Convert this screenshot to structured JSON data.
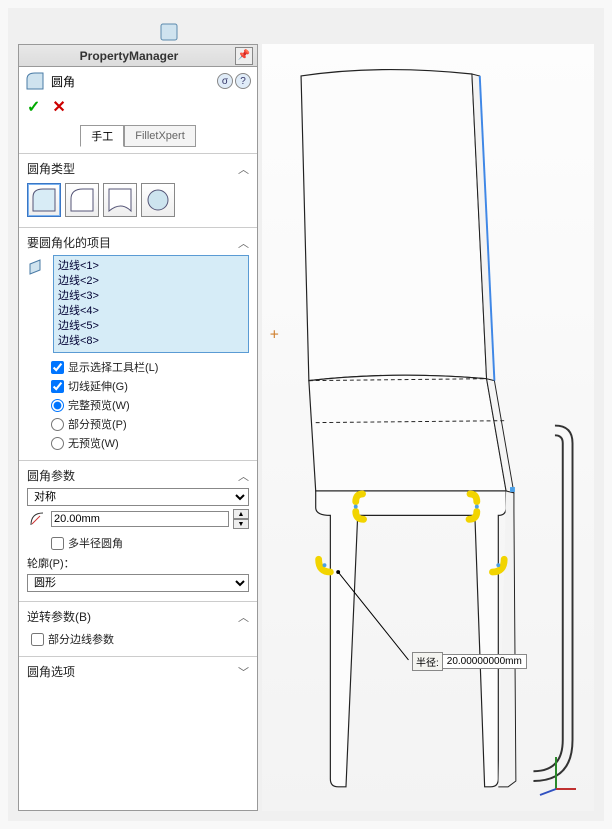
{
  "panel": {
    "title": "PropertyManager",
    "feature_name": "圆角",
    "tabs": {
      "manual": "手工",
      "xpert": "FilletXpert"
    },
    "sections": {
      "type": "圆角类型",
      "items": "要圆角化的项目",
      "params": "圆角参数",
      "reverse": "逆转参数(B)",
      "options": "圆角选项"
    },
    "edges": [
      "边线<1>",
      "边线<2>",
      "边线<3>",
      "边线<4>",
      "边线<5>",
      "边线<8>"
    ],
    "checks": {
      "show_toolbar": "显示选择工具栏(L)",
      "tangent": "切线延伸(G)"
    },
    "preview": {
      "full": "完整预览(W)",
      "partial": "部分预览(P)",
      "none": "无预览(W)"
    },
    "symmetry": "对称",
    "radius_value": "20.00mm",
    "multi_radius": "多半径圆角",
    "profile_label": "轮廓(P)：",
    "profile_value": "圆形",
    "partial_edge": "部分边线参数"
  },
  "callout": {
    "label": "半径:",
    "value": "20.00000000mm"
  },
  "chart_data": {
    "type": "table",
    "title": "Fillet radius",
    "values": [
      20.0
    ],
    "unit": "mm"
  }
}
